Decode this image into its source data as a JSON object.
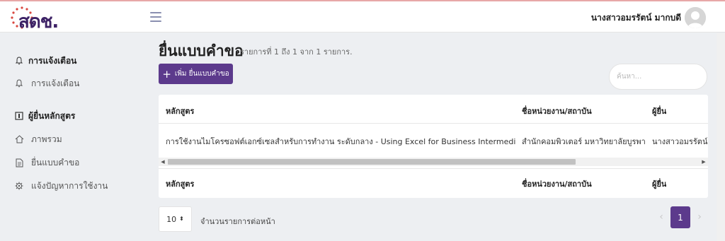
{
  "brand": {
    "logo_text": "สดช."
  },
  "header": {
    "user_name": "นางสาวอมรรัตน์ มากบดี"
  },
  "sidebar": {
    "sections": [
      {
        "title": "การแจ้งเตือน",
        "items": [
          {
            "label": "การแจ้งเตือน",
            "icon": "bell-icon"
          }
        ]
      },
      {
        "title": "ผู้ยื่นหลักสูตร",
        "items": [
          {
            "label": "ภาพรวม",
            "icon": "home-icon"
          },
          {
            "label": "ยื่นแบบคำขอ",
            "icon": "document-icon"
          },
          {
            "label": "แจ้งปัญหาการใช้งาน",
            "icon": "bug-icon"
          }
        ]
      }
    ]
  },
  "main": {
    "title": "ยื่นแบบคำขอ",
    "count_text": "รายการที่ 1 ถึง 1 จาก 1 รายการ.",
    "add_button": "เพิ่ม ยื่นแบบคำขอ",
    "search_placeholder": "ค้นหา..."
  },
  "table": {
    "columns": [
      "หลักสูตร",
      "ชื่อหน่วยงาน/สถาบัน",
      "ผู้ยื่น"
    ],
    "rows": [
      [
        "การใช้งานไมโครซอฟต์เอกซ์เซลสำหรับการทำงาน ระดับกลาง - Using Excel for Business Intermediate",
        "สำนักคอมพิวเตอร์ มหาวิทยาลัยบูรพา",
        "นางสาวอมรรัตน์ มากบดี"
      ]
    ],
    "footer_columns": [
      "หลักสูตร",
      "ชื่อหน่วยงาน/สถาบัน",
      "ผู้ยื่น"
    ]
  },
  "pagination": {
    "per_page": "10",
    "per_page_label": "จำนวนรายการต่อหน้า",
    "current_page": "1",
    "prev": "‹",
    "next": "›"
  },
  "colors": {
    "accent": "#5c3a8c",
    "logo_dots": "#d9473f"
  }
}
